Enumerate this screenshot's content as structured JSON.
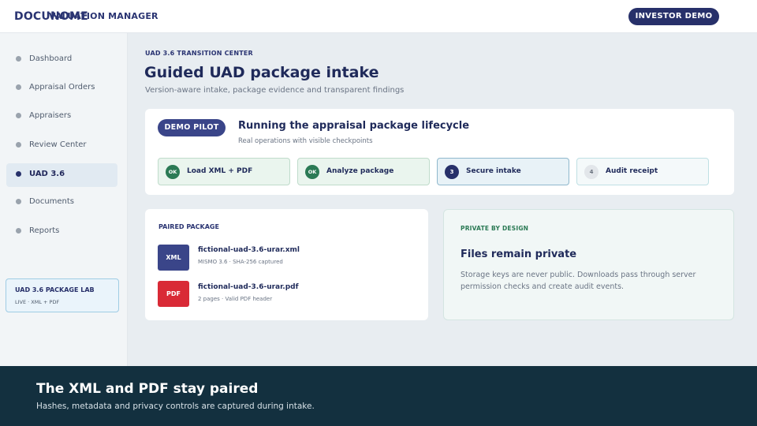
{
  "header": {
    "brand": "DOCUNOME",
    "app_title": "VALUATION MANAGER",
    "demo_button": "INVESTOR DEMO"
  },
  "sidebar": {
    "items": [
      {
        "label": "Dashboard"
      },
      {
        "label": "Appraisal Orders"
      },
      {
        "label": "Appraisers"
      },
      {
        "label": "Review Center"
      },
      {
        "label": "UAD 3.6",
        "active": true
      },
      {
        "label": "Documents"
      },
      {
        "label": "Reports"
      }
    ],
    "lab_card": {
      "title": "UAD 3.6 PACKAGE LAB",
      "subtitle": "LIVE · XML + PDF"
    }
  },
  "main": {
    "eyebrow": "UAD 3.6 TRANSITION CENTER",
    "title": "Guided UAD package intake",
    "subtitle": "Version-aware intake, package evidence and transparent findings",
    "lifecycle": {
      "pill": "DEMO PILOT",
      "title": "Running the appraisal package lifecycle",
      "subtitle": "Real operations with visible checkpoints",
      "steps": [
        {
          "badge": "OK",
          "label": "Load XML + PDF",
          "state": "done"
        },
        {
          "badge": "OK",
          "label": "Analyze package",
          "state": "done"
        },
        {
          "badge": "3",
          "label": "Secure intake",
          "state": "current"
        },
        {
          "badge": "4",
          "label": "Audit receipt",
          "state": "pending"
        }
      ]
    },
    "package": {
      "heading": "PAIRED PACKAGE",
      "files": [
        {
          "icon": "XML",
          "name": "fictional-uad-3.6-urar.xml",
          "meta": "MISMO 3.6 · SHA-256 captured"
        },
        {
          "icon": "PDF",
          "name": "fictional-uad-3.6-urar.pdf",
          "meta": "2 pages · Valid PDF header"
        }
      ]
    },
    "privacy": {
      "eyebrow": "PRIVATE BY DESIGN",
      "title": "Files remain private",
      "text": "Storage keys are never public. Downloads pass through server permission checks and create audit events."
    }
  },
  "footer": {
    "title": "The XML and PDF stay paired",
    "subtitle": "Hashes, metadata and privacy controls are captured during intake."
  },
  "colors": {
    "navy": "#27306a",
    "green": "#2b7a55",
    "pdf_red": "#d92a36",
    "footer_bg": "#13303f"
  }
}
